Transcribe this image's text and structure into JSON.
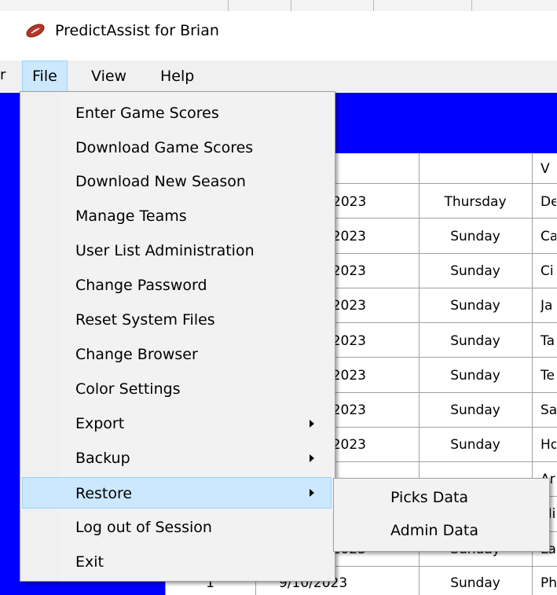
{
  "window": {
    "title": "PredictAssist for Brian",
    "icon": "football-icon",
    "partial_left_text": "r"
  },
  "menubar": {
    "items": [
      {
        "label": "File",
        "open": true
      },
      {
        "label": "View"
      },
      {
        "label": "Help"
      }
    ]
  },
  "file_menu": {
    "items": [
      {
        "label": "Enter Game Scores"
      },
      {
        "label": "Download Game Scores"
      },
      {
        "label": "Download New Season"
      },
      {
        "label": "Manage Teams"
      },
      {
        "label": "User List Administration"
      },
      {
        "label": "Change Password"
      },
      {
        "label": "Reset System Files"
      },
      {
        "label": "Change Browser"
      },
      {
        "label": "Color Settings"
      },
      {
        "label": "Export",
        "submenu": true
      },
      {
        "label": "Backup",
        "submenu": true
      },
      {
        "label": "Restore",
        "submenu": true,
        "highlighted": true
      },
      {
        "label": "Log out of Session"
      },
      {
        "label": "Exit"
      }
    ]
  },
  "restore_submenu": {
    "items": [
      {
        "label": "Picks Data"
      },
      {
        "label": "Admin Data"
      }
    ]
  },
  "grid": {
    "header": [
      "",
      "",
      "V"
    ],
    "rows": [
      {
        "week": "",
        "date": "2023",
        "day": "Thursday",
        "visitor": "De"
      },
      {
        "week": "",
        "date": "/2023",
        "day": "Sunday",
        "visitor": "Ca"
      },
      {
        "week": "",
        "date": "/2023",
        "day": "Sunday",
        "visitor": "Ci"
      },
      {
        "week": "",
        "date": "/2023",
        "day": "Sunday",
        "visitor": "Ja"
      },
      {
        "week": "",
        "date": "/2023",
        "day": "Sunday",
        "visitor": "Ta"
      },
      {
        "week": "",
        "date": "/2023",
        "day": "Sunday",
        "visitor": "Te"
      },
      {
        "week": "",
        "date": "/2023",
        "day": "Sunday",
        "visitor": "Sa"
      },
      {
        "week": "",
        "date": "/2023",
        "day": "Sunday",
        "visitor": "Ho"
      },
      {
        "week": "",
        "date": "",
        "day": "",
        "visitor": "Ar"
      },
      {
        "week": "",
        "date": "",
        "day": "",
        "visitor": "Mi"
      },
      {
        "week": "",
        "date": "/2023",
        "day": "Sunday",
        "visitor": "La"
      },
      {
        "week": "1",
        "date": "9/10/2023",
        "day": "Sunday",
        "visitor": "Ph"
      }
    ]
  },
  "colors": {
    "band": "#0000ff",
    "highlight": "#cce8ff",
    "highlight_border": "#99d1ff",
    "menu_bg": "#f2f2f2"
  }
}
